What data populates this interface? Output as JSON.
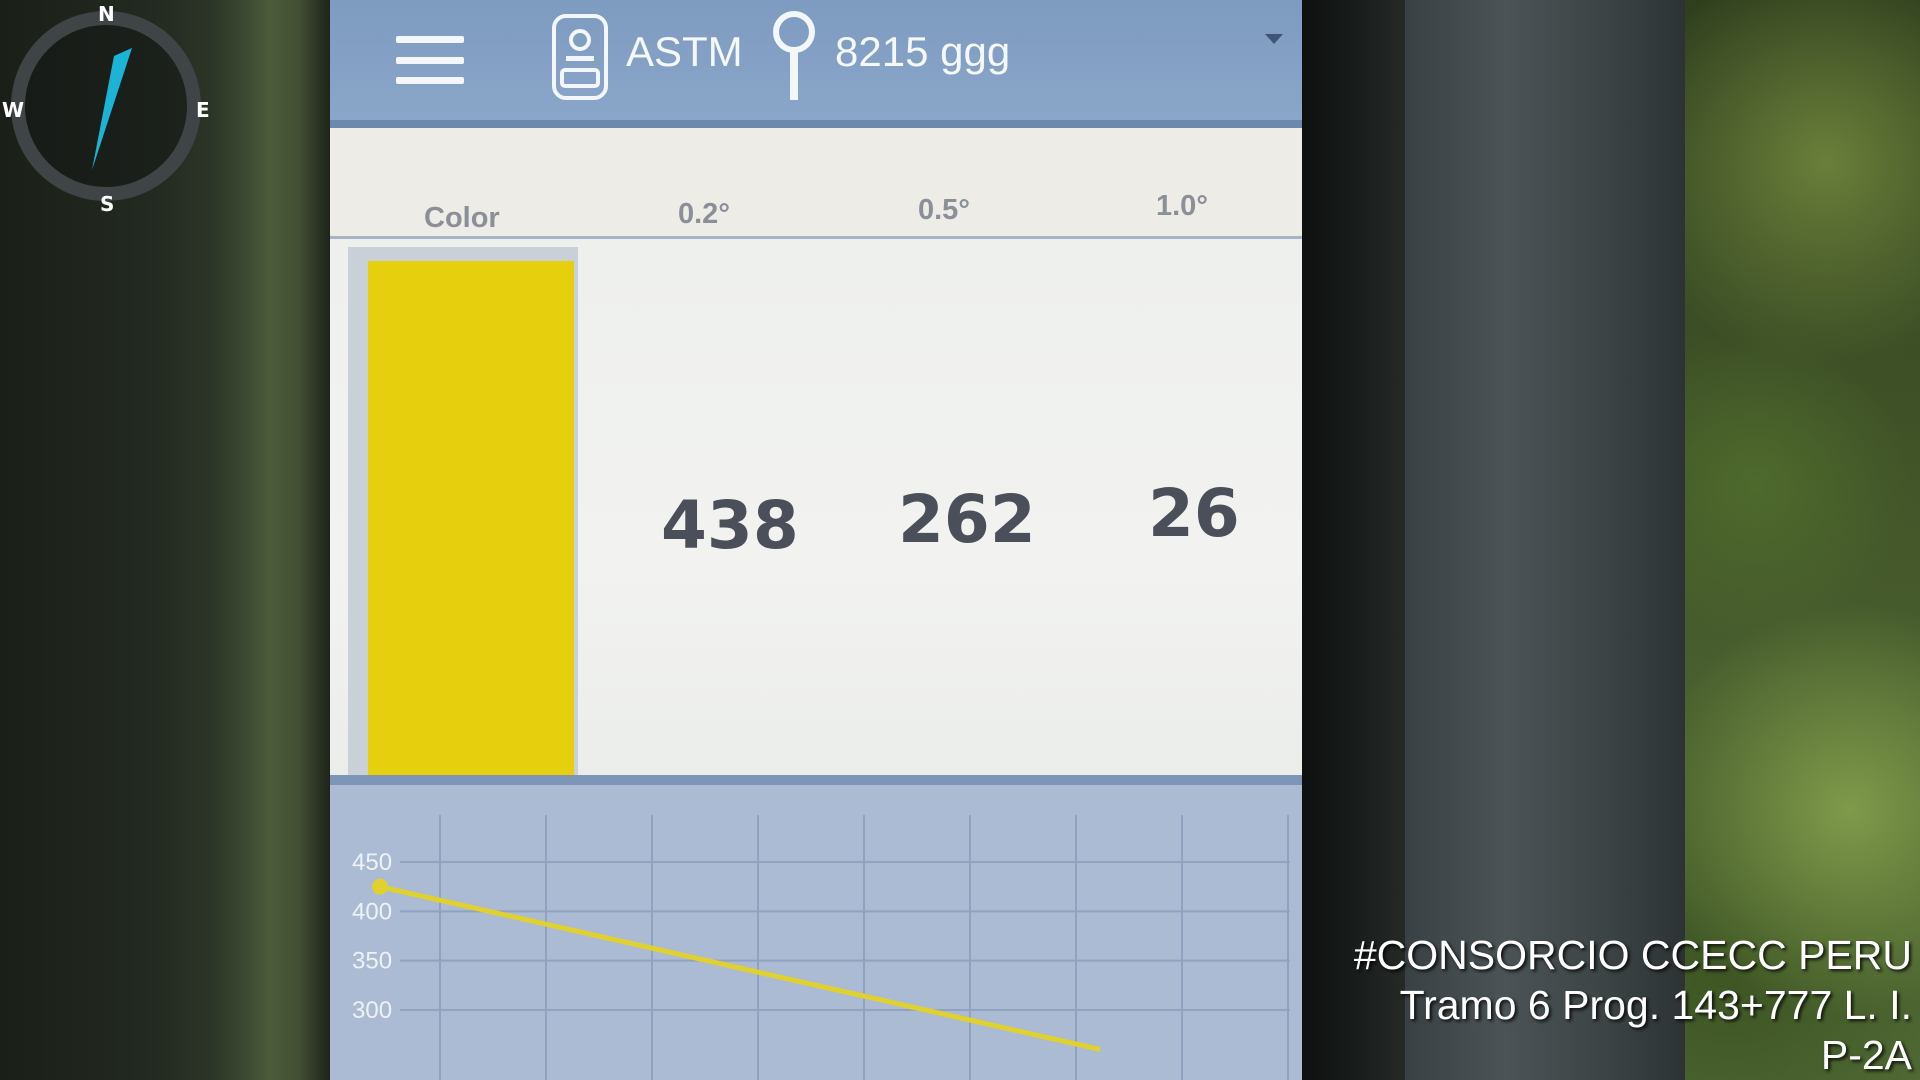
{
  "compass": {
    "north": "N",
    "east": "E",
    "south": "S",
    "west": "W",
    "needle_color": "#1cb4d6"
  },
  "header": {
    "menu_icon": "hamburger-menu-icon",
    "device_icon": "retroreflectometer-icon",
    "standard": "ASTM",
    "location_icon": "map-pin-icon",
    "location": "8215 ggg",
    "dropdown_icon": "caret-down-icon"
  },
  "table": {
    "columns": [
      "Color",
      "0.2°",
      "0.5°",
      "1.0°"
    ],
    "swatch_color": "#e6cf0c",
    "values": [
      "438",
      "262",
      "26"
    ]
  },
  "chart_data": {
    "type": "line",
    "y_tick_labels": [
      "450",
      "400",
      "350",
      "300"
    ],
    "ylim": [
      280,
      460
    ],
    "series": [
      {
        "points": [
          [
            0,
            425
          ],
          [
            3,
            260
          ]
        ],
        "color": "#e0d030"
      }
    ],
    "grid": true
  },
  "overlay": {
    "line1": "#CONSORCIO CCECC PERU",
    "line2": "Tramo 6 Prog. 143+777 L. I.",
    "line3": "P-2A"
  }
}
